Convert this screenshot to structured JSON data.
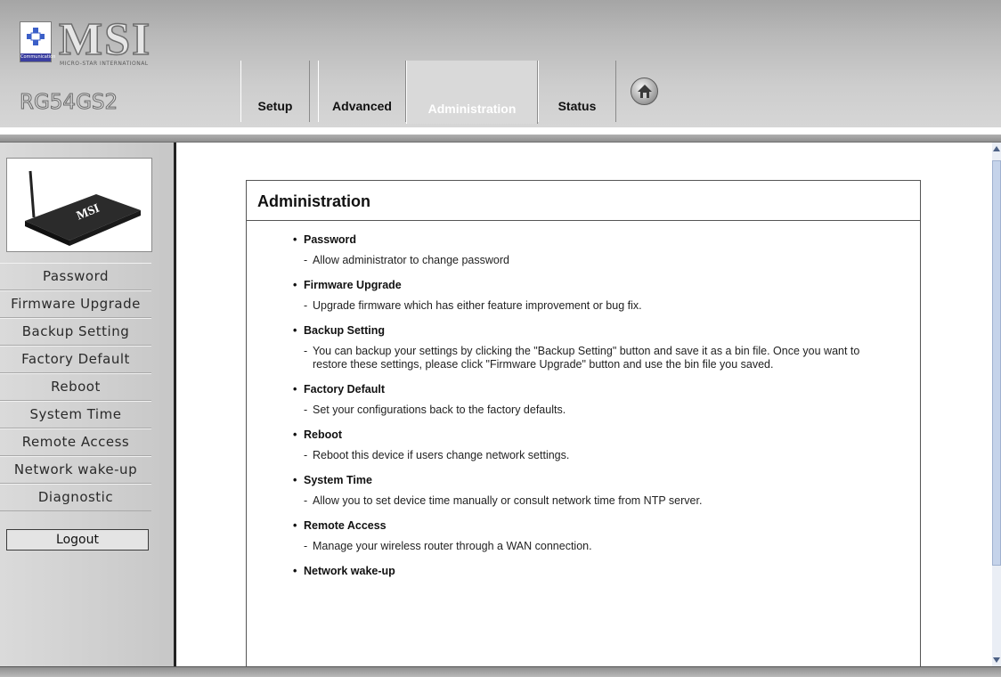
{
  "header": {
    "brand": "MSI",
    "brand_subtitle": "MICRO-STAR INTERNATIONAL",
    "badge_text": "Communication",
    "model": "RG54GS2",
    "tabs": [
      {
        "label": "Setup",
        "active": false
      },
      {
        "label": "Advanced",
        "active": false
      },
      {
        "label": "Administration",
        "active": true
      },
      {
        "label": "Status",
        "active": false
      }
    ],
    "home_icon": "home-icon"
  },
  "sidebar": {
    "device_label": "MSI",
    "items": [
      {
        "label": "Password"
      },
      {
        "label": "Firmware Upgrade"
      },
      {
        "label": "Backup Setting"
      },
      {
        "label": "Factory Default"
      },
      {
        "label": "Reboot"
      },
      {
        "label": "System Time"
      },
      {
        "label": "Remote Access"
      },
      {
        "label": "Network wake-up"
      },
      {
        "label": "Diagnostic"
      }
    ],
    "logout_label": "Logout"
  },
  "main": {
    "title": "Administration",
    "entries": [
      {
        "title": "Password",
        "desc": "Allow administrator to change password"
      },
      {
        "title": "Firmware Upgrade",
        "desc": "Upgrade firmware which has either feature improvement or bug fix."
      },
      {
        "title": "Backup Setting",
        "desc": "You can backup your settings by clicking the \"Backup Setting\" button and save it as a bin file. Once you want to restore these settings, please click \"Firmware Upgrade\" button and use the bin file you saved."
      },
      {
        "title": "Factory Default",
        "desc": "Set your configurations back to the factory defaults."
      },
      {
        "title": "Reboot",
        "desc": "Reboot this device if users change network settings."
      },
      {
        "title": "System Time",
        "desc": "Allow you to set device time manually or consult network time from NTP server."
      },
      {
        "title": "Remote Access",
        "desc": "Manage your wireless router through a WAN connection."
      },
      {
        "title": "Network wake-up",
        "desc": ""
      }
    ]
  },
  "colors": {
    "header_gray": "#b9b9b9",
    "sidebar_gray": "#d3d3d3",
    "active_tab_text": "#ffffff",
    "scroll_thumb": "#c5d3ea"
  }
}
